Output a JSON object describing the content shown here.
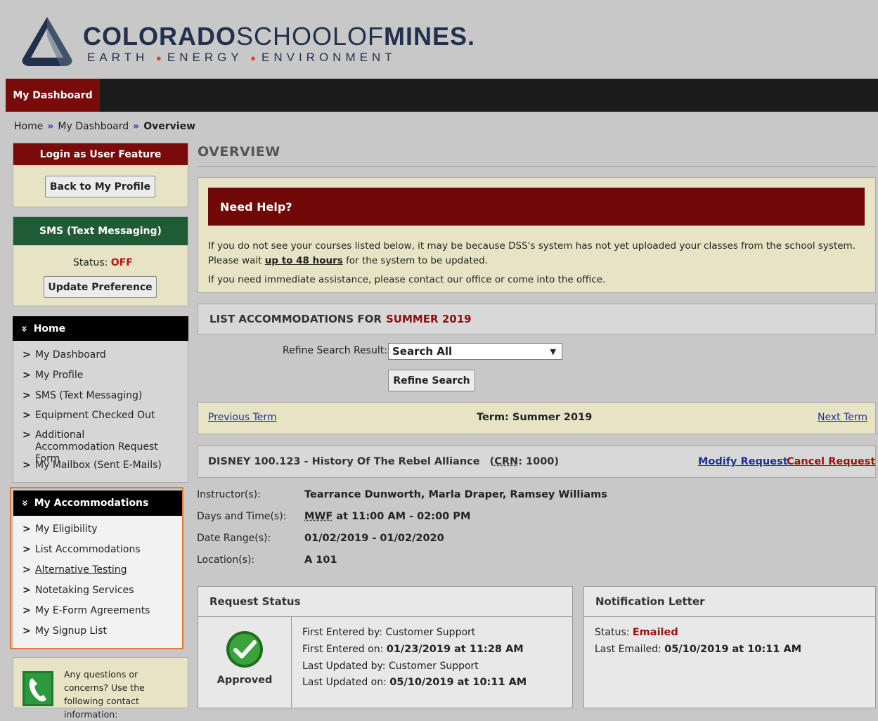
{
  "header": {
    "brand_bold_1": "COLORADO",
    "brand_light": "SCHOOLOF",
    "brand_bold_2": "MINES",
    "brand_dot": ".",
    "tag_1": "EARTH",
    "tag_2": "ENERGY",
    "tag_3": "ENVIRONMENT",
    "tag_sep": "●"
  },
  "nav": {
    "tab_label": "My Dashboard"
  },
  "breadcrumb": {
    "home": "Home",
    "sep": "»",
    "dashboard": "My Dashboard",
    "current": "Overview"
  },
  "sidebar": {
    "login_feature": {
      "title": "Login as User Feature",
      "button": "Back to My Profile"
    },
    "sms": {
      "title": "SMS (Text Messaging)",
      "status_label": "Status:",
      "status_value": "OFF",
      "button": "Update Preference"
    },
    "home_menu": {
      "title": "Home",
      "head_icon": "»",
      "items": [
        {
          "label": "My Dashboard"
        },
        {
          "label": "My Profile"
        },
        {
          "label": "SMS (Text Messaging)"
        },
        {
          "label": "Equipment Checked Out"
        },
        {
          "label": "Additional Accommodation Request Form"
        },
        {
          "label": "My Mailbox (Sent E-Mails)"
        }
      ]
    },
    "accommodations_menu": {
      "title": "My Accommodations",
      "items": [
        {
          "label": "My Eligibility"
        },
        {
          "label": "List Accommodations"
        },
        {
          "label": "Alternative Testing"
        },
        {
          "label": "Notetaking Services"
        },
        {
          "label": "My E-Form Agreements"
        },
        {
          "label": "My Signup List"
        }
      ]
    },
    "contact": {
      "text": "Any questions or concerns? Use the following contact information:"
    },
    "chevron": ">"
  },
  "main": {
    "title": "OVERVIEW",
    "help": {
      "title": "Need Help?",
      "p1_before": "If you do not see your courses listed below, it may be because DSS's system has not yet uploaded your classes from the school system. Please wait ",
      "p1_link": "up to 48 hours",
      "p1_after": " for the system to be updated.",
      "p2": "If you need immediate assistance, please contact our office or come into the office."
    },
    "list": {
      "heading": "LIST ACCOMMODATIONS FOR",
      "term": "SUMMER 2019"
    },
    "refine": {
      "label": "Refine Search Result:",
      "selected": "Search All",
      "caret": "▼",
      "button": "Refine Search"
    },
    "term_nav": {
      "previous": "Previous Term",
      "current": "Term: Summer 2019",
      "next": "Next Term"
    },
    "course": {
      "title": "DISNEY 100.123 - History Of The Rebel Alliance",
      "crn_open": "(",
      "crn_label": "CRN",
      "crn_value": ": 1000)",
      "modify": "Modify Request",
      "cancel": "Cancel Request",
      "details": {
        "instructor_label": "Instructor(s):",
        "instructor_value": "Tearrance Dunworth, Marla Draper, Ramsey Williams",
        "days_label": "Days and Time(s):",
        "days_code": "MWF",
        "days_value": " at 11:00 AM - 02:00 PM",
        "range_label": "Date Range(s):",
        "range_value": "01/02/2019 - 01/02/2020",
        "location_label": "Location(s):",
        "location_value": "A 101"
      }
    },
    "request_status": {
      "title": "Request Status",
      "status": "Approved",
      "first_entered_by_label": "First Entered by:",
      "first_entered_by": "Customer Support",
      "first_entered_on_label": "First Entered on:",
      "first_entered_on": "01/23/2019 at 11:28 AM",
      "last_updated_by_label": "Last Updated by:",
      "last_updated_by": "Customer Support",
      "last_updated_on_label": "Last Updated on:",
      "last_updated_on": "05/10/2019 at 10:11 AM"
    },
    "notification": {
      "title": "Notification Letter",
      "status_label": "Status:",
      "status_value": "Emailed",
      "last_emailed_label": "Last Emailed:",
      "last_emailed_value": "05/10/2019 at 10:11 AM"
    }
  },
  "colors": {
    "brand_red": "#7a0b0b",
    "brand_green": "#1f5b35",
    "link_blue": "#1f2f9a",
    "highlight_orange": "#e8763a",
    "approved_green": "#2f8a2f"
  }
}
